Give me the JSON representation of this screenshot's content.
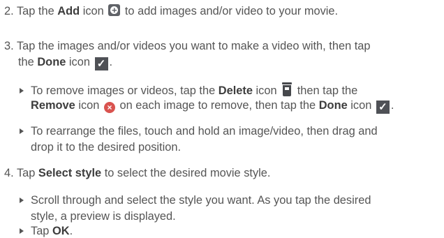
{
  "steps": [
    {
      "number": "2.",
      "t1": "Tap the ",
      "b1": "Add",
      "t2": " icon",
      "t3": " to add images and/or video to your movie."
    },
    {
      "number": "3.",
      "line1": "Tap the images and/or videos you want to make a video with, then tap",
      "t1": "the ",
      "b1": "Done",
      "t2": " icon",
      "t3": "."
    },
    {
      "bullets": [
        {
          "t1": "To remove images or videos, tap the ",
          "b1": "Delete",
          "t2": " icon",
          "t3": " then tap the",
          "b2": "Remove",
          "t4": " icon",
          "t5": " on each image to remove, then tap the ",
          "b3": "Done",
          "t6": " icon",
          "t7": "."
        },
        {
          "line1": "To rearrange the files, touch and hold an image/video, then drag and",
          "line2": "drop it to the desired position."
        }
      ]
    },
    {
      "number": "4.",
      "t1": "Tap ",
      "b1": "Select style",
      "t2": " to select the desired movie style."
    },
    {
      "bullets": [
        {
          "line1": "Scroll through and select the style you want. As you tap the desired",
          "line2": "style, a preview is displayed."
        },
        {
          "t1": "Tap ",
          "b1": "OK",
          "t2": "."
        }
      ]
    }
  ],
  "icons": {
    "add": "add-circle-icon",
    "done": "checkmark-icon",
    "delete": "trash-icon",
    "remove": "remove-x-icon"
  }
}
